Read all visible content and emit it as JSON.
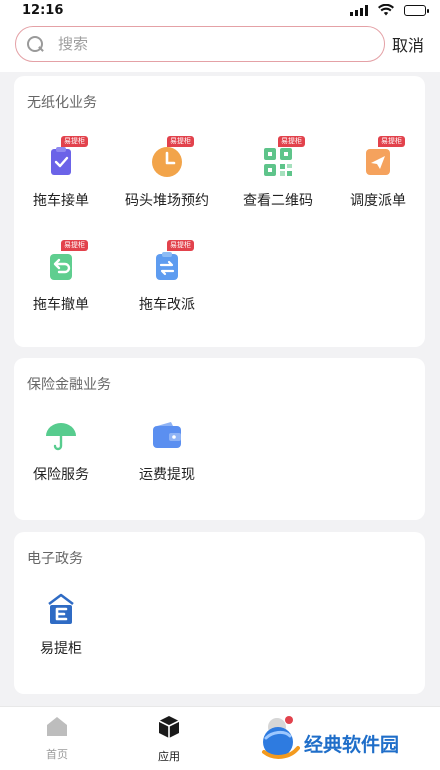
{
  "status": {
    "time": "12:16"
  },
  "search": {
    "placeholder": "搜索",
    "cancel_label": "取消"
  },
  "sections": [
    {
      "title": "无纸化业务",
      "items": [
        {
          "label": "拖车接单",
          "icon": "clipboard-check-icon",
          "badge": "易提柜",
          "color": "#6b63e8"
        },
        {
          "label": "码头堆场预约",
          "icon": "clock-icon",
          "badge": "易提柜",
          "color": "#f2a44a"
        },
        {
          "label": "查看二维码",
          "icon": "qr-code-icon",
          "badge": "易提柜",
          "color": "#5ec48a"
        },
        {
          "label": "调度派单",
          "icon": "send-icon",
          "badge": "易提柜",
          "color": "#f5a25d"
        },
        {
          "label": "拖车撤单",
          "icon": "undo-document-icon",
          "badge": "易提柜",
          "color": "#5fce8f"
        },
        {
          "label": "拖车改派",
          "icon": "swap-document-icon",
          "badge": "易提柜",
          "color": "#5e9cf0"
        }
      ]
    },
    {
      "title": "保险金融业务",
      "items": [
        {
          "label": "保险服务",
          "icon": "umbrella-icon",
          "color": "#57cc8e"
        },
        {
          "label": "运费提现",
          "icon": "wallet-icon",
          "color": "#5b8ff0"
        }
      ]
    },
    {
      "title": "电子政务",
      "items": [
        {
          "label": "易提柜",
          "icon": "e-box-icon",
          "color": "#2f6bc4"
        }
      ]
    }
  ],
  "tabbar": {
    "items": [
      {
        "label": "首页",
        "icon": "home-icon",
        "active": false
      },
      {
        "label": "应用",
        "icon": "cube-icon",
        "active": true
      }
    ]
  },
  "watermark": {
    "text": "经典软件园"
  }
}
